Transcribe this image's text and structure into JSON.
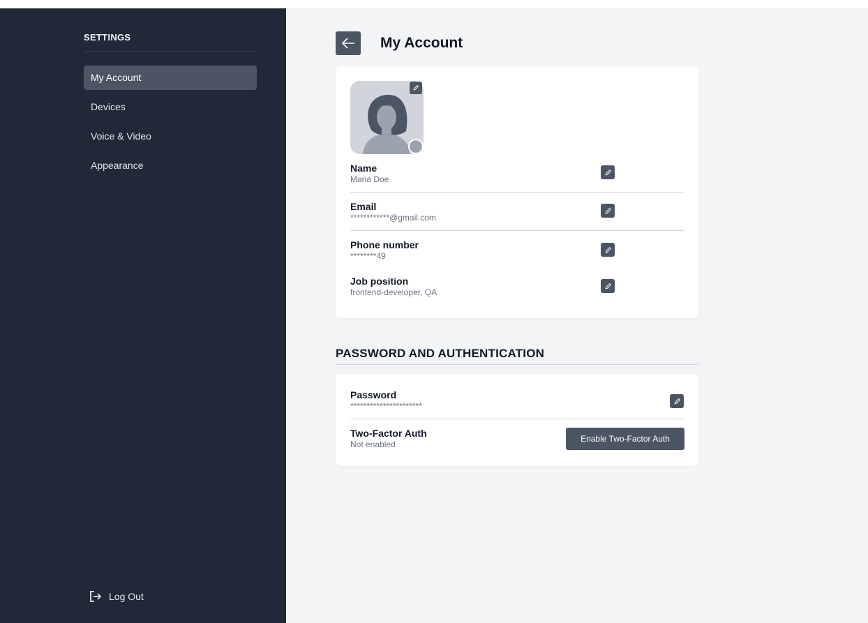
{
  "sidebar": {
    "header": "SETTINGS",
    "items": [
      {
        "label": "My Account",
        "active": true
      },
      {
        "label": "Devices"
      },
      {
        "label": "Voice & Video"
      },
      {
        "label": "Appearance"
      }
    ],
    "logout_label": "Log Out"
  },
  "main": {
    "title": "My Account",
    "account": {
      "fields": [
        {
          "label": "Name",
          "value": "Maria Doe"
        },
        {
          "label": "Email",
          "value": "************@gmail.com"
        },
        {
          "label": "Phone number",
          "value": "********49"
        },
        {
          "label": "Job position",
          "value": "frontend-developer, QA"
        }
      ]
    },
    "auth_section": {
      "title": "PASSWORD AND AUTHENTICATION",
      "password": {
        "label": "Password",
        "value": "**********************"
      },
      "twofa": {
        "label": "Two-Factor Auth",
        "value": "Not enabled",
        "button_label": "Enable Two-Factor Auth"
      }
    }
  },
  "colors": {
    "sidebar_bg": "#1f2937",
    "main_bg": "#f3f4f6",
    "accent": "#4b5563"
  },
  "icons": {
    "back": "arrow-left-icon",
    "edit": "pencil-icon",
    "logout": "logout-icon"
  }
}
